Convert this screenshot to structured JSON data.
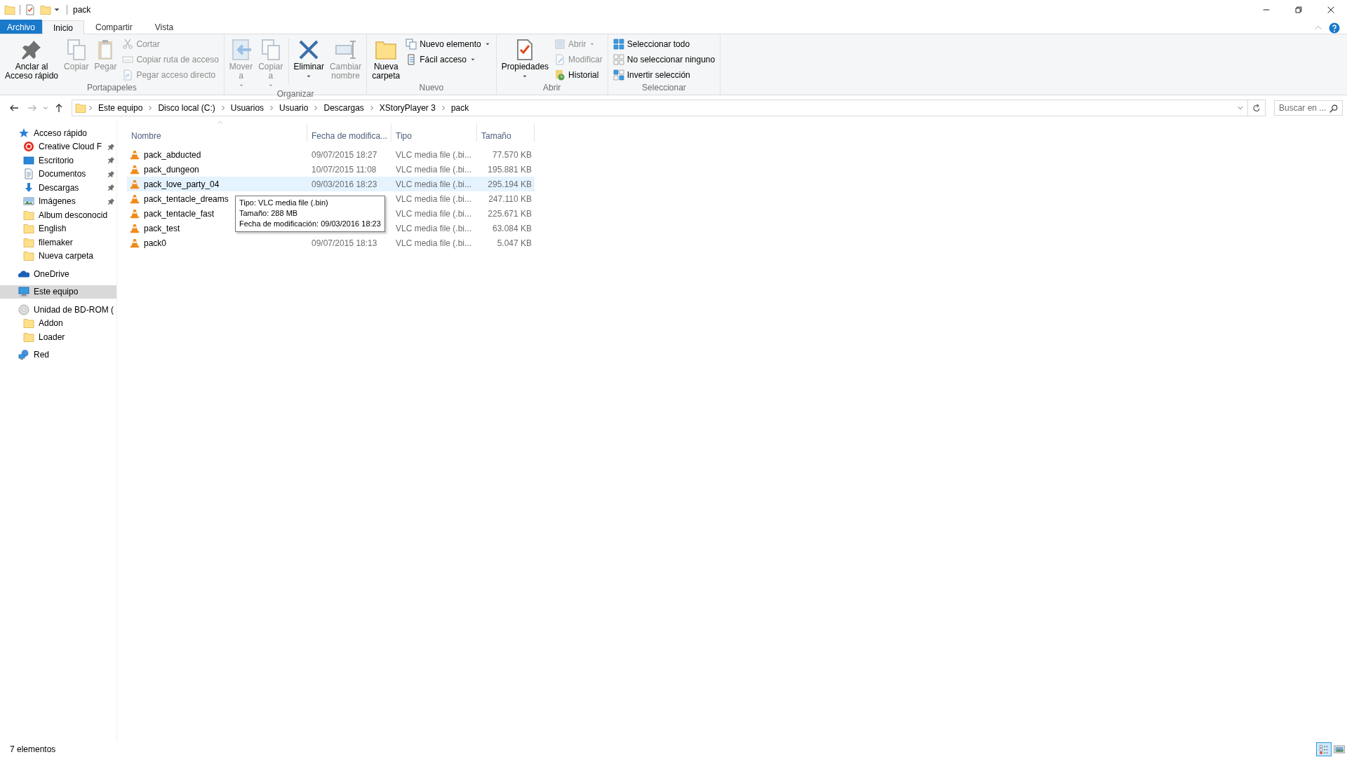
{
  "title_bar": {
    "title": "pack"
  },
  "ribbon": {
    "tabs": [
      {
        "label": "Archivo",
        "kind": "file",
        "selected": false
      },
      {
        "label": "Inicio",
        "kind": "tab",
        "selected": true
      },
      {
        "label": "Compartir",
        "kind": "tab",
        "selected": false
      },
      {
        "label": "Vista",
        "kind": "tab",
        "selected": false
      }
    ],
    "groups": [
      {
        "name": "Portapapeles",
        "items": [
          {
            "kind": "large",
            "label": "Anclar al\nAcceso rápido",
            "disabled": false,
            "dropdown": false
          },
          {
            "kind": "large",
            "label": "Copiar",
            "disabled": true,
            "dropdown": false
          },
          {
            "kind": "large",
            "label": "Pegar",
            "disabled": true,
            "dropdown": false
          },
          {
            "kind": "small",
            "label": "Cortar",
            "disabled": true,
            "dropdown": false
          },
          {
            "kind": "small",
            "label": "Copiar ruta de acceso",
            "disabled": true,
            "dropdown": false
          },
          {
            "kind": "small",
            "label": "Pegar acceso directo",
            "disabled": true,
            "dropdown": false
          }
        ]
      },
      {
        "name": "Organizar",
        "items": [
          {
            "kind": "large",
            "label": "Mover\na",
            "disabled": true,
            "dropdown": true
          },
          {
            "kind": "large",
            "label": "Copiar\na",
            "disabled": true,
            "dropdown": true
          },
          {
            "kind": "large",
            "label": "Eliminar",
            "disabled": false,
            "dropdown": true,
            "separator_before": true
          },
          {
            "kind": "large",
            "label": "Cambiar\nnombre",
            "disabled": true,
            "dropdown": false
          }
        ]
      },
      {
        "name": "Nuevo",
        "items": [
          {
            "kind": "large",
            "label": "Nueva\ncarpeta",
            "disabled": false,
            "dropdown": false
          },
          {
            "kind": "small",
            "label": "Nuevo elemento",
            "disabled": false,
            "dropdown": true
          },
          {
            "kind": "small",
            "label": "Fácil acceso",
            "disabled": false,
            "dropdown": true
          }
        ]
      },
      {
        "name": "Abrir",
        "items": [
          {
            "kind": "large",
            "label": "Propiedades",
            "disabled": false,
            "dropdown": true
          },
          {
            "kind": "small",
            "label": "Abrir",
            "disabled": true,
            "dropdown": true
          },
          {
            "kind": "small",
            "label": "Modificar",
            "disabled": true,
            "dropdown": false
          },
          {
            "kind": "small",
            "label": "Historial",
            "disabled": false,
            "dropdown": false
          }
        ]
      },
      {
        "name": "Seleccionar",
        "items": [
          {
            "kind": "small",
            "label": "Seleccionar todo",
            "disabled": false,
            "dropdown": false
          },
          {
            "kind": "small",
            "label": "No seleccionar ninguno",
            "disabled": false,
            "dropdown": false
          },
          {
            "kind": "small",
            "label": "Invertir selección",
            "disabled": false,
            "dropdown": false
          }
        ]
      }
    ]
  },
  "address_bar": {
    "forward_disabled": true,
    "path": [
      "Este equipo",
      "Disco local (C:)",
      "Usuarios",
      "Usuario",
      "Descargas",
      "XStoryPlayer 3",
      "pack"
    ],
    "search": {
      "placeholder": "Buscar en ..."
    }
  },
  "navigation_pane": {
    "items": [
      {
        "label": "Acceso rápido",
        "selected": false,
        "children": [
          {
            "label": "Creative Cloud F",
            "pinned": true,
            "selected": false
          },
          {
            "label": "Escritorio",
            "pinned": true,
            "selected": false
          },
          {
            "label": "Documentos",
            "pinned": true,
            "selected": false
          },
          {
            "label": "Descargas",
            "pinned": true,
            "selected": false
          },
          {
            "label": "Imágenes",
            "pinned": true,
            "selected": false
          },
          {
            "label": "Album desconocid",
            "selected": false
          },
          {
            "label": "English",
            "selected": false
          },
          {
            "label": "filemaker",
            "selected": false
          },
          {
            "label": "Nueva carpeta",
            "selected": false
          }
        ]
      },
      {
        "label": "OneDrive",
        "selected": false
      },
      {
        "label": "Este equipo",
        "selected": true
      },
      {
        "label": "Unidad de BD-ROM (",
        "selected": false,
        "children": [
          {
            "label": "Addon",
            "selected": false
          },
          {
            "label": "Loader",
            "selected": false
          }
        ]
      },
      {
        "label": "Red",
        "selected": false
      }
    ]
  },
  "file_list": {
    "columns": [
      {
        "label": "Nombre",
        "sorted": true
      },
      {
        "label": "Fecha de modifica...",
        "sorted": false
      },
      {
        "label": "Tipo",
        "sorted": false
      },
      {
        "label": "Tamaño",
        "sorted": false
      }
    ],
    "rows": [
      {
        "name": "pack_abducted",
        "date": "09/07/2015 18:27",
        "type": "VLC media file (.bi...",
        "size": "77.570 KB",
        "highlighted": false
      },
      {
        "name": "pack_dungeon",
        "date": "10/07/2015 11:08",
        "type": "VLC media file (.bi...",
        "size": "195.881 KB",
        "highlighted": false
      },
      {
        "name": "pack_love_party_04",
        "date": "09/03/2016 18:23",
        "type": "VLC media file (.bi...",
        "size": "295.194 KB",
        "highlighted": true
      },
      {
        "name": "pack_tentacle_dreams",
        "type": "VLC media file (.bi...",
        "size": "247.110 KB",
        "highlighted": false
      },
      {
        "name": "pack_tentacle_fast",
        "type": "VLC media file (.bi...",
        "size": "225.671 KB",
        "highlighted": false
      },
      {
        "name": "pack_test",
        "type": "VLC media file (.bi...",
        "size": "63.084 KB",
        "highlighted": false
      },
      {
        "name": "pack0",
        "date": "09/07/2015 18:13",
        "type": "VLC media file (.bi...",
        "size": "5.047 KB",
        "highlighted": false
      }
    ],
    "tooltip": [
      "Tipo: VLC media file (.bin)",
      "Tamaño: 288 MB",
      "Fecha de modificación: 09/03/2016 18:23"
    ]
  },
  "status_bar": {
    "text": "7 elementos",
    "views": [
      {
        "kind": "details",
        "selected": true
      },
      {
        "kind": "large_icons",
        "selected": false
      }
    ]
  }
}
